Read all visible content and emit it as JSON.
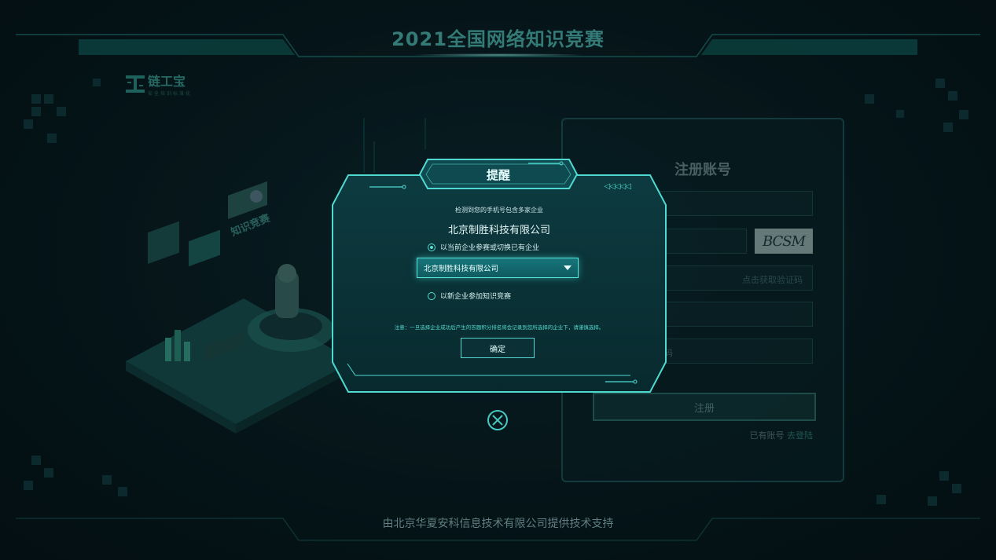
{
  "header": {
    "title": "2021全国网络知识竞赛"
  },
  "logo": {
    "name": "链工宝",
    "subtitle": "安全培训标准化"
  },
  "illustration": {
    "sign": "知识竞赛"
  },
  "register_card": {
    "title": "注册账号",
    "captcha_text": "BCSM",
    "get_code_label": "点击获取验证码",
    "password_hint": "码",
    "submit_label": "注册",
    "has_account_label": "已有账号",
    "login_link": "去登陆"
  },
  "modal": {
    "title": "提醒",
    "arrows": "◁◁◁◁◁",
    "description": "检测到您的手机号包含多家企业",
    "current_company": "北京制胜科技有限公司",
    "option_current_label": "以当前企业参赛或切换已有企业",
    "select_value": "北京制胜科技有限公司",
    "option_new_label": "以新企业参加知识竞赛",
    "note": "注意：一旦选择企业成功后产生的答题积分排名将会记录到您所选择的企业下，请谨慎选择。",
    "confirm_label": "确定",
    "close_icon": "close-icon"
  },
  "footer": {
    "text": "由北京华夏安科信息技术有限公司提供技术支持"
  },
  "colors": {
    "accent": "#4fd9d0",
    "background": "#071a1e",
    "title": "#4fb6b0"
  }
}
